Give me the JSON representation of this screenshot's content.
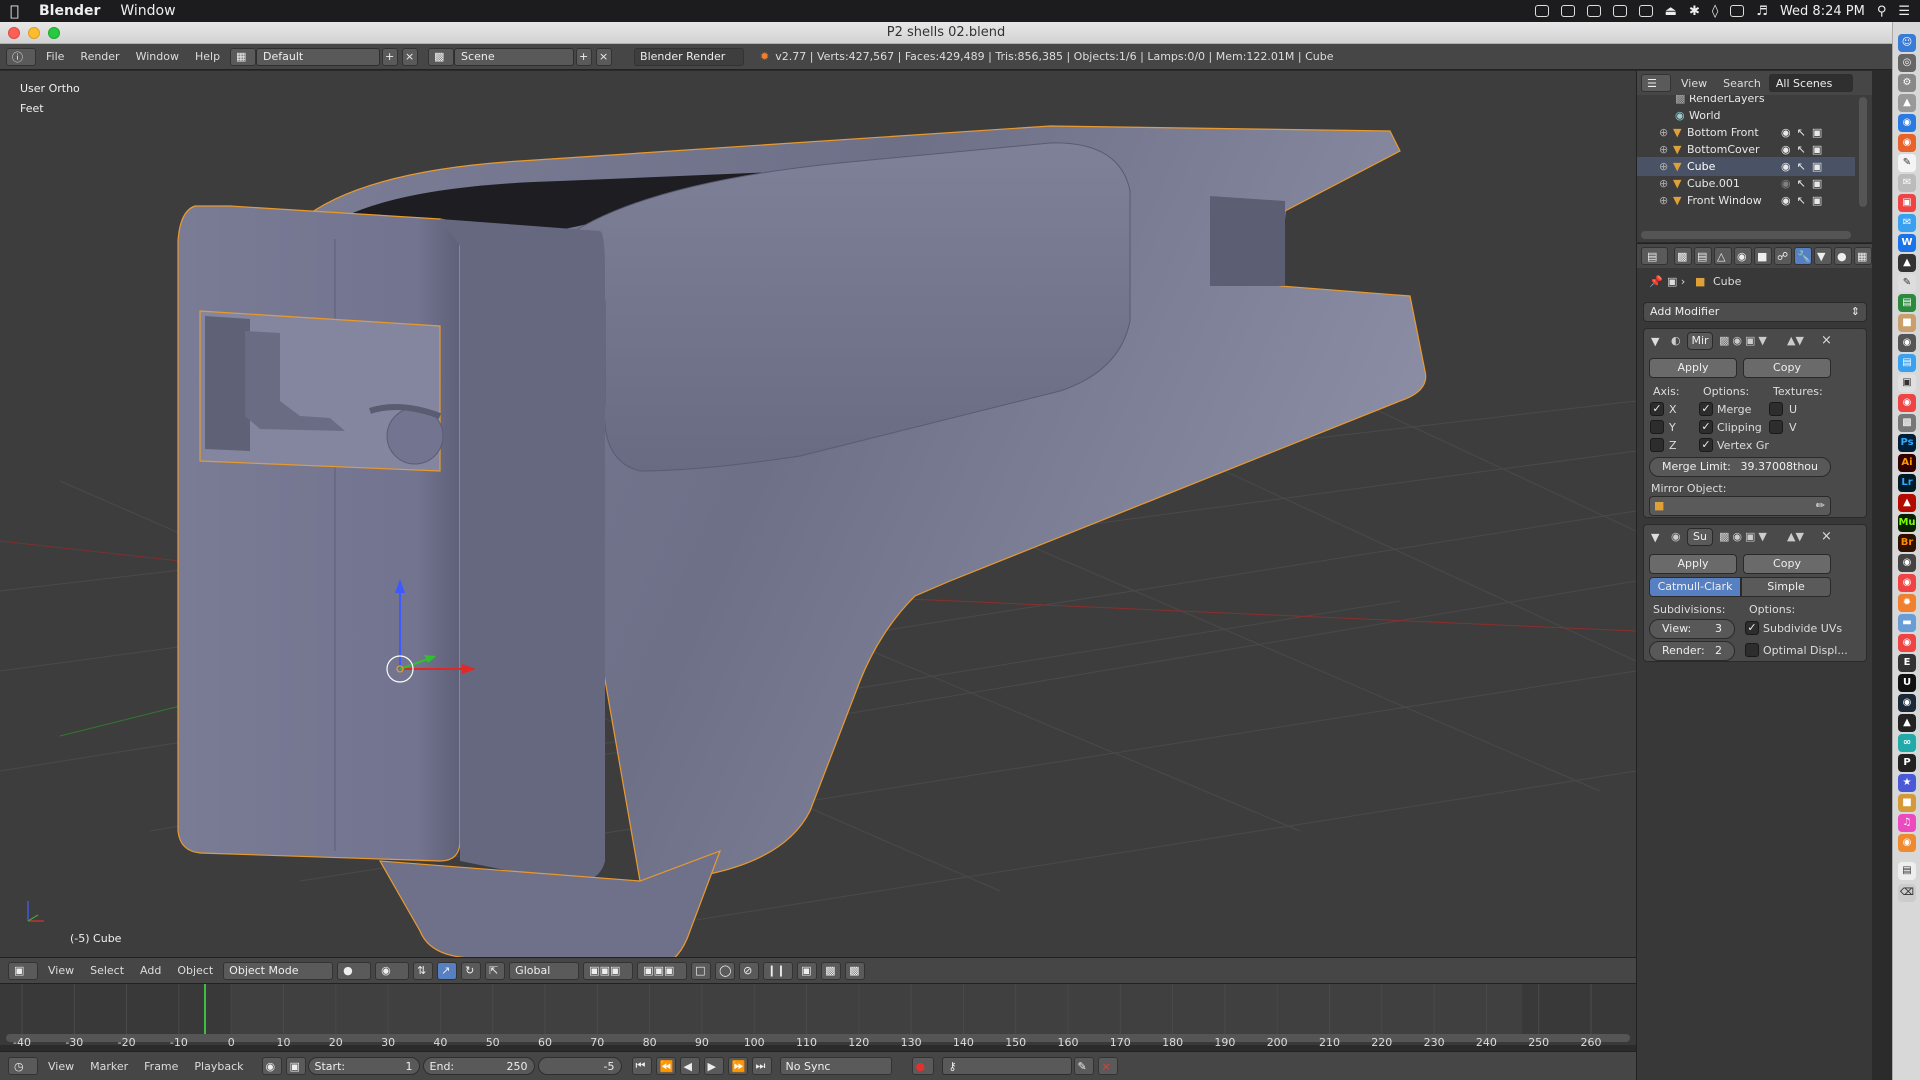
{
  "menubar": {
    "app": "Blender",
    "items": [
      "Window"
    ],
    "clock": "Wed 8:24 PM"
  },
  "window": {
    "title": "P2 shells 02.blend"
  },
  "info": {
    "menus": [
      "File",
      "Render",
      "Window",
      "Help"
    ],
    "layout": "Default",
    "scene": "Scene",
    "engine": "Blender Render",
    "stats": "v2.77 | Verts:427,567 | Faces:429,489 | Tris:856,385 | Objects:1/6 | Lamps:0/0 | Mem:122.01M | Cube"
  },
  "viewport": {
    "view_name": "User Ortho",
    "units": "Feet",
    "object_label": "(-5) Cube",
    "colors": {
      "background": "#3d3d3d",
      "mesh": "#7a7c94",
      "selection": "#e89a30"
    }
  },
  "view3d_header": {
    "menus": [
      "View",
      "Select",
      "Add",
      "Object"
    ],
    "mode": "Object Mode",
    "orientation": "Global"
  },
  "timeline": {
    "ticks": [
      "-40",
      "-30",
      "-20",
      "-10",
      "0",
      "10",
      "20",
      "30",
      "40",
      "50",
      "60",
      "70",
      "80",
      "90",
      "100",
      "110",
      "120",
      "130",
      "140",
      "150",
      "160",
      "170",
      "180",
      "190",
      "200",
      "210",
      "220",
      "230",
      "240",
      "250",
      "260"
    ],
    "menus": [
      "View",
      "Marker",
      "Frame",
      "Playback"
    ],
    "start_label": "Start:",
    "start": "1",
    "end_label": "End:",
    "end": "250",
    "current": "-5",
    "sync": "No Sync"
  },
  "outliner": {
    "menus": [
      "View",
      "Search"
    ],
    "filter": "All Scenes",
    "items": [
      {
        "name": "RenderLayers"
      },
      {
        "name": "World"
      },
      {
        "name": "Bottom Front"
      },
      {
        "name": "BottomCover"
      },
      {
        "name": "Cube"
      },
      {
        "name": "Cube.001"
      },
      {
        "name": "Front Window"
      }
    ]
  },
  "properties": {
    "context": "Cube",
    "add_modifier": "Add Modifier",
    "mirror": {
      "name": "Mir",
      "apply": "Apply",
      "copy": "Copy",
      "axis_label": "Axis:",
      "options_label": "Options:",
      "textures_label": "Textures:",
      "axis": [
        {
          "label": "X",
          "checked": true
        },
        {
          "label": "Y",
          "checked": false
        },
        {
          "label": "Z",
          "checked": false
        }
      ],
      "options": [
        {
          "label": "Merge",
          "checked": true
        },
        {
          "label": "Clipping",
          "checked": true
        },
        {
          "label": "Vertex Gr",
          "checked": true
        }
      ],
      "textures": [
        {
          "label": "U",
          "checked": false
        },
        {
          "label": "V",
          "checked": false
        }
      ],
      "merge_limit_label": "Merge Limit:",
      "merge_limit": "39.37008thou",
      "mirror_object_label": "Mirror Object:"
    },
    "subsurf": {
      "name": "Su",
      "apply": "Apply",
      "copy": "Copy",
      "type_catmull": "Catmull-Clark",
      "type_simple": "Simple",
      "subdivisions_label": "Subdivisions:",
      "options_label": "Options:",
      "view_label": "View:",
      "view": "3",
      "render_label": "Render:",
      "render": "2",
      "subdivide_uvs": "Subdivide UVs",
      "subdivide_uvs_checked": true,
      "optimal_display": "Optimal Displ...",
      "optimal_display_checked": false
    }
  },
  "dock": {
    "icons": [
      "Ps",
      "Ai",
      "Lr",
      "Br",
      "Mu",
      "P"
    ]
  }
}
